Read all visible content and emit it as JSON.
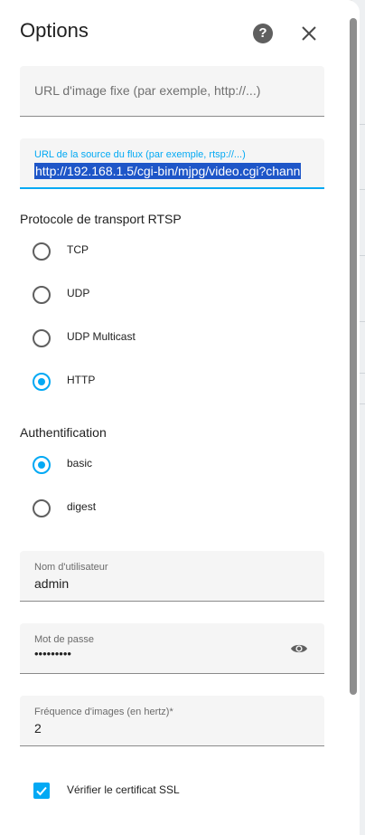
{
  "dialog": {
    "title": "Options",
    "help_icon": "help-circle-icon",
    "close_icon": "close-icon"
  },
  "still_image_url": {
    "placeholder": "URL d'image fixe (par exemple, http://...)",
    "value": ""
  },
  "stream_source": {
    "label": "URL de la source du flux (par exemple, rtsp://...)",
    "value": "http://192.168.1.5/cgi-bin/mjpg/video.cgi?chann",
    "selected": true
  },
  "rtsp_transport": {
    "title": "Protocole de transport RTSP",
    "options": [
      {
        "label": "TCP",
        "checked": false
      },
      {
        "label": "UDP",
        "checked": false
      },
      {
        "label": "UDP Multicast",
        "checked": false
      },
      {
        "label": "HTTP",
        "checked": true
      }
    ]
  },
  "authentication": {
    "title": "Authentification",
    "options": [
      {
        "label": "basic",
        "checked": true
      },
      {
        "label": "digest",
        "checked": false
      }
    ]
  },
  "username": {
    "label": "Nom d'utilisateur",
    "value": "admin"
  },
  "password": {
    "label": "Mot de passe",
    "value": "•••••••••",
    "toggle_icon": "eye-icon"
  },
  "framerate": {
    "label": "Fréquence d'images (en hertz)*",
    "value": "2"
  },
  "verify_ssl": {
    "label": "Vérifier le certificat SSL",
    "checked": true
  },
  "colors": {
    "accent": "#03a9f4",
    "selection": "#1e56c8"
  }
}
